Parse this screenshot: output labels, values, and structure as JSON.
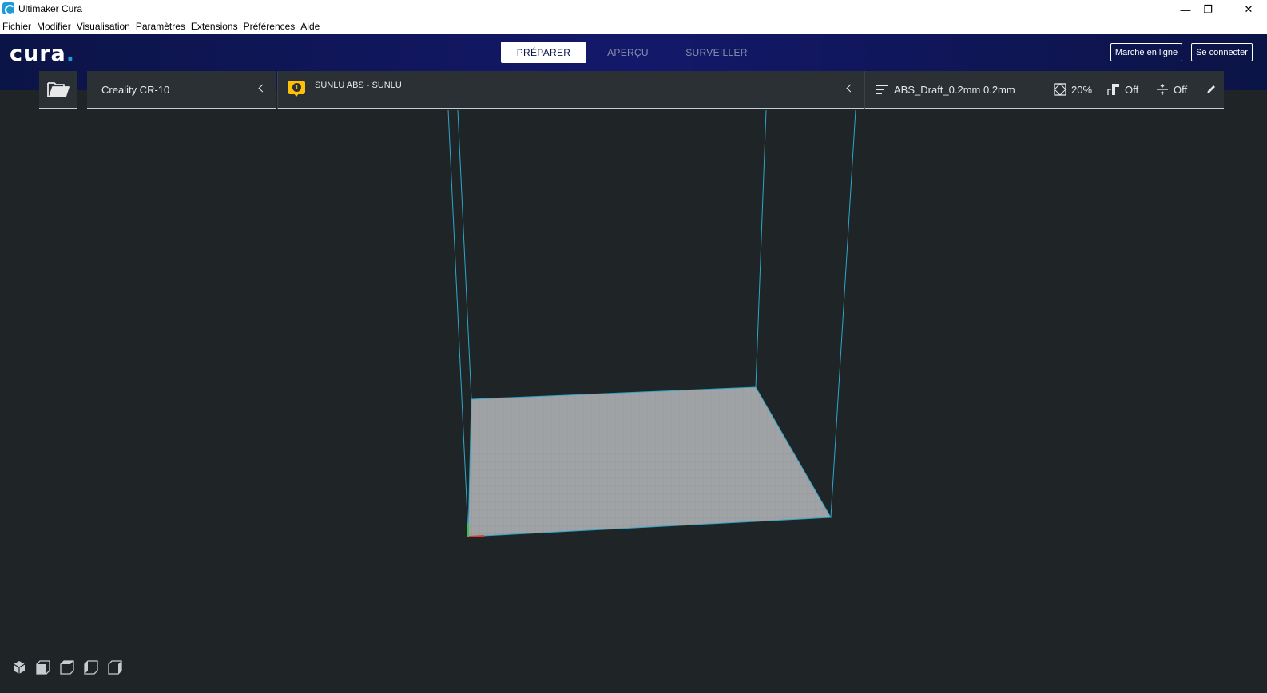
{
  "window": {
    "title": "Ultimaker Cura",
    "min_glyph": "—",
    "max_glyph": "❐",
    "close_glyph": "✕"
  },
  "menu": {
    "items": [
      "Fichier",
      "Modifier",
      "Visualisation",
      "Paramètres",
      "Extensions",
      "Préférences",
      "Aide"
    ]
  },
  "header": {
    "logo_text": "cura",
    "logo_dot": ".",
    "stages": [
      {
        "label": "PRÉPARER",
        "active": true
      },
      {
        "label": "APERÇU",
        "active": false
      },
      {
        "label": "SURVEILLER",
        "active": false
      }
    ],
    "marketplace_label": "Marché en ligne",
    "login_label": "Se connecter"
  },
  "toolbar": {
    "open_icon": "folder-open-icon",
    "printer_name": "Creality CR-10",
    "material": {
      "extruder_number": "1",
      "name": "SUNLU ABS - SUNLU",
      "badge_color": "#ffc107"
    },
    "profile": {
      "name": "ABS_Draft_0.2mm 0.2mm",
      "infill": "20%",
      "support": "Off",
      "adhesion": "Off"
    }
  },
  "viewport": {
    "background_color": "#1f2427",
    "build_volume_color": "#2fa6c8",
    "plate_color": "#a0a3a5",
    "view_buttons": [
      "3d-view-icon",
      "front-view-icon",
      "top-view-icon",
      "left-view-icon",
      "right-view-icon"
    ]
  },
  "colors": {
    "header_bg": "#0b1446",
    "accent": "#1e9bd7",
    "panel_bg": "#2b3034"
  }
}
